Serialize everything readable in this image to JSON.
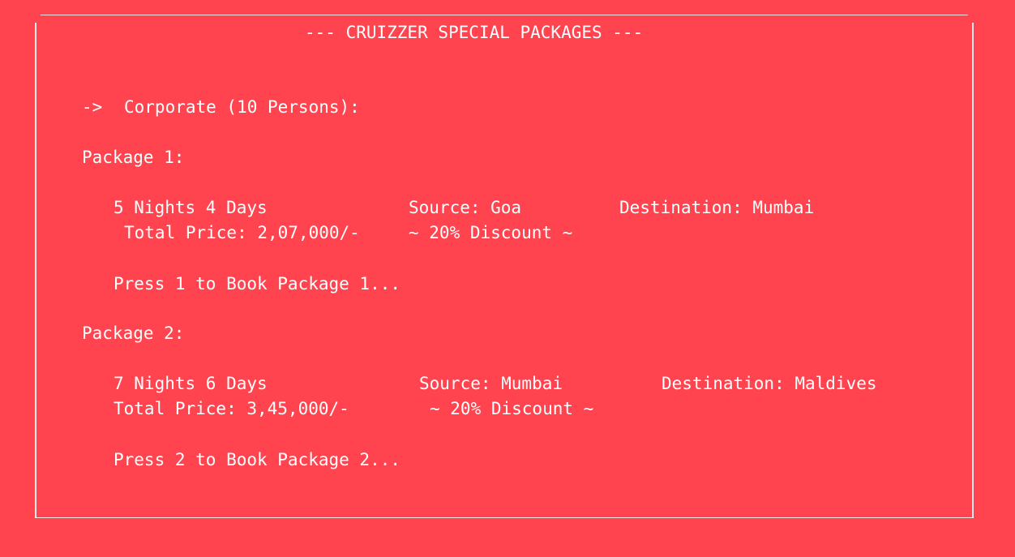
{
  "header": {
    "title": "--- CRUIZZER SPECIAL PACKAGES ---"
  },
  "category": {
    "arrow": "->",
    "label": "Corporate (10 Persons):"
  },
  "packages": [
    {
      "heading": "Package 1:",
      "duration": "5 Nights 4 Days",
      "source": "Source: Goa",
      "destination": "Destination: Mumbai",
      "price": "Total Price: 2,07,000/-",
      "discount": "~ 20% Discount ~",
      "prompt": "Press 1 to Book Package 1..."
    },
    {
      "heading": "Package 2:",
      "duration": "7 Nights 6 Days",
      "source": "Source: Mumbai",
      "destination": "Destination: Maldives",
      "price": "Total Price: 3,45,000/-",
      "discount": "~ 20% Discount ~",
      "prompt": "Press 2 to Book Package 2..."
    }
  ],
  "colors": {
    "background": "#FF444F",
    "text": "#FFFFFF"
  }
}
